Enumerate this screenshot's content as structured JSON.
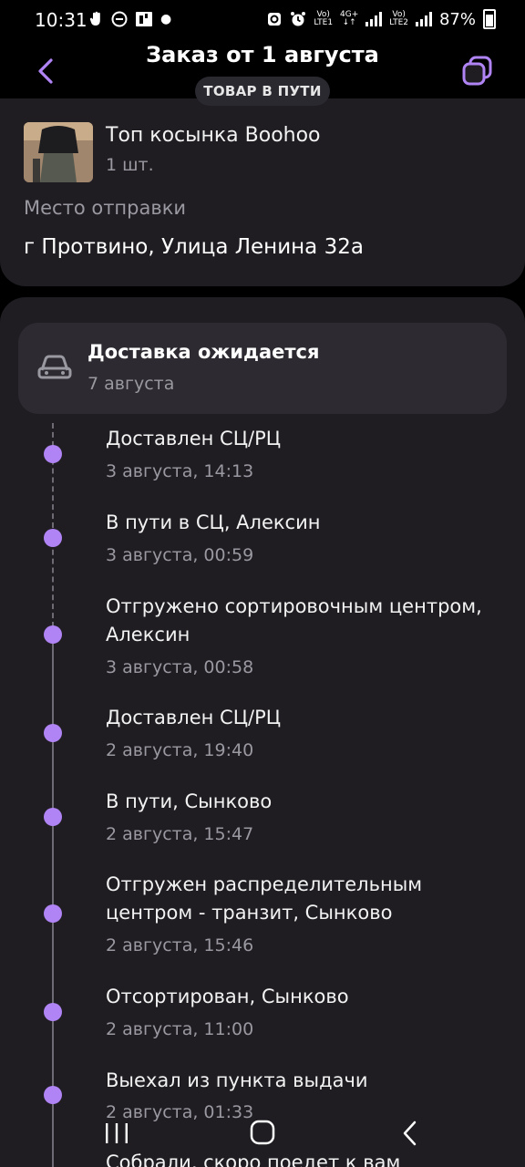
{
  "status_bar": {
    "time": "10:31",
    "net1": "Vo)",
    "lte1": "LTE1",
    "g4": "4G+",
    "net2": "Vo)",
    "lte2": "LTE2",
    "battery": "87%"
  },
  "header": {
    "title": "Заказ от 1 августа",
    "status": "ТОВАР В ПУТИ"
  },
  "product": {
    "name": "Топ косынка Boohoo",
    "qty": "1 шт.",
    "from_label": "Место отправки",
    "from_value": "г Протвино, Улица Ленина 32а"
  },
  "delivery": {
    "title": "Доставка ожидается",
    "date": "7 августа"
  },
  "events": [
    {
      "title": "Доставлен СЦ/РЦ",
      "time": "3 августа, 14:13"
    },
    {
      "title": "В пути в СЦ, Алексин",
      "time": "3 августа, 00:59"
    },
    {
      "title": "Отгружено сортировочным центром, Алексин",
      "time": "3 августа, 00:58"
    },
    {
      "title": "Доставлен СЦ/РЦ",
      "time": "2 августа, 19:40"
    },
    {
      "title": "В пути, Сынково",
      "time": "2 августа, 15:47"
    },
    {
      "title": "Отгружен распределительным центром - транзит, Сынково",
      "time": "2 августа, 15:46"
    },
    {
      "title": "Отсортирован, Сынково",
      "time": "2 августа, 11:00"
    },
    {
      "title": "Выехал из пункта выдачи",
      "time": "2 августа, 01:33"
    },
    {
      "title": "Собрали, скоро поедет к вам",
      "time": ""
    }
  ],
  "colors": {
    "accent": "#b084f5",
    "card": "#1f1d22",
    "background": "#000000",
    "muted_text": "#9a98a0"
  }
}
